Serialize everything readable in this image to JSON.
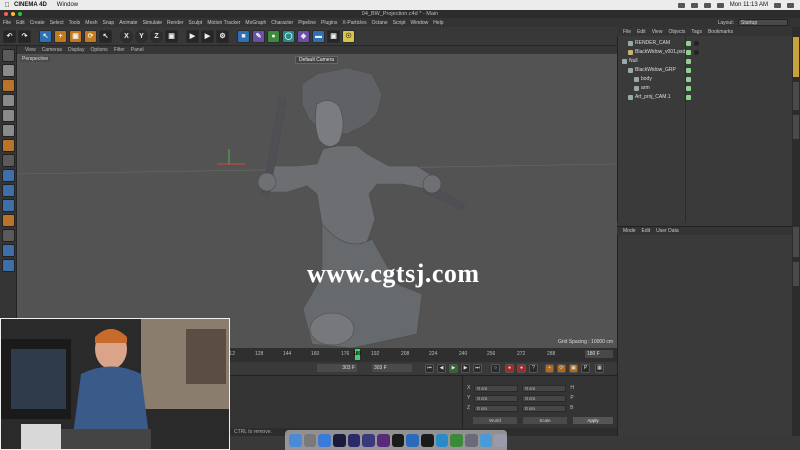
{
  "macbar": {
    "app_name": "CINEMA 4D",
    "menu": [
      "Window"
    ],
    "clock": "Mon 11:13 AM"
  },
  "window": {
    "title": "04_BW_Projection.c4d * - Main"
  },
  "c4d_menu": {
    "items": [
      "File",
      "Edit",
      "Create",
      "Select",
      "Tools",
      "Mesh",
      "Snap",
      "Animate",
      "Simulate",
      "Render",
      "Sculpt",
      "Motion Tracker",
      "MoGraph",
      "Character",
      "Pipeline",
      "Plugins",
      "X-Particles",
      "Octane",
      "Script",
      "Window",
      "Help"
    ],
    "layout_label": "Layout:",
    "layout_value": "Startup"
  },
  "toolbar": {
    "axis_x": "X",
    "axis_y": "Y",
    "axis_z": "Z"
  },
  "viewport_menu": {
    "items": [
      "View",
      "Cameras",
      "Display",
      "Options",
      "Filter",
      "Panel"
    ]
  },
  "viewport": {
    "projection": "Perspective",
    "camera": "Default Camera",
    "grid_spacing": "Grid Spacing : 10000 cm",
    "watermark": "www.cgtsj.com"
  },
  "timeline": {
    "ticks": [
      "112",
      "128",
      "144",
      "160",
      "176",
      "180",
      "192",
      "208",
      "224",
      "240",
      "256",
      "272",
      "288"
    ],
    "current_frame": "180",
    "end_frame": "180 F"
  },
  "transport": {
    "field_start": "303 F",
    "field_end": "303 F"
  },
  "object_manager": {
    "menu": [
      "File",
      "Edit",
      "View",
      "Objects",
      "Tags",
      "Bookmarks"
    ],
    "objects": [
      {
        "name": "RENDER_CAM",
        "indent": 1
      },
      {
        "name": "BlackWidow_v001.psd",
        "indent": 1
      },
      {
        "name": "Null",
        "indent": 0
      },
      {
        "name": "BlackWidow_GRP",
        "indent": 1
      },
      {
        "name": "body",
        "indent": 2
      },
      {
        "name": "arm",
        "indent": 2
      },
      {
        "name": "Art_proj_CAM.1",
        "indent": 1
      }
    ]
  },
  "attribute_manager": {
    "menu": [
      "Mode",
      "Edit",
      "User Data"
    ]
  },
  "coordinates": {
    "rows": [
      {
        "axis": "X",
        "pos": "0 cm",
        "size": "0 cm",
        "rot_label": "H",
        "rot": "0°"
      },
      {
        "axis": "Y",
        "pos": "0 cm",
        "size": "0 cm",
        "rot_label": "P",
        "rot": "0°"
      },
      {
        "axis": "Z",
        "pos": "0 cm",
        "size": "0 cm",
        "rot_label": "B",
        "rot": "0°"
      }
    ],
    "world_label": "World",
    "size_label": "Scale",
    "apply_label": "Apply"
  },
  "status": {
    "text": "CTRL to remove."
  },
  "colors": {
    "accent_timeline": "#3fd06a",
    "watermark": "#ffffff"
  }
}
